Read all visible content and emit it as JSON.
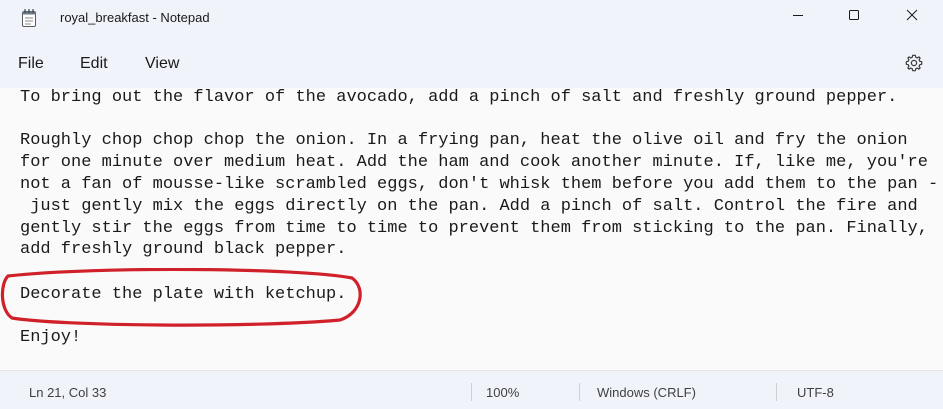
{
  "window": {
    "title": "royal_breakfast - Notepad"
  },
  "icons": {
    "app": "notepad-icon",
    "minimize": "minimize-icon",
    "maximize": "maximize-icon",
    "close": "close-icon",
    "settings": "gear-icon"
  },
  "menu": {
    "file": "File",
    "edit": "Edit",
    "view": "View"
  },
  "editor": {
    "lines": [
      "To bring out the flavor of the avocado, add a pinch of salt and freshly ground pepper.",
      "",
      "Roughly chop chop chop the onion. In a frying pan, heat the olive oil and fry the onion",
      "for one minute over medium heat. Add the ham and cook another minute. If, like me, you're",
      "not a fan of mousse-like scrambled eggs, don't whisk them before you add them to the pan -",
      " just gently mix the eggs directly on the pan. Add a pinch of salt. Control the fire and",
      "gently stir the eggs from time to time to prevent them from sticking to the pan. Finally,",
      "add freshly ground black pepper.",
      "",
      "Decorate the plate with ketchup.",
      "",
      "Enjoy!"
    ]
  },
  "annotation": {
    "color": "#d0202a"
  },
  "status": {
    "position": "Ln 21, Col 33",
    "zoom": "100%",
    "line_ending": "Windows (CRLF)",
    "encoding": "UTF-8"
  }
}
